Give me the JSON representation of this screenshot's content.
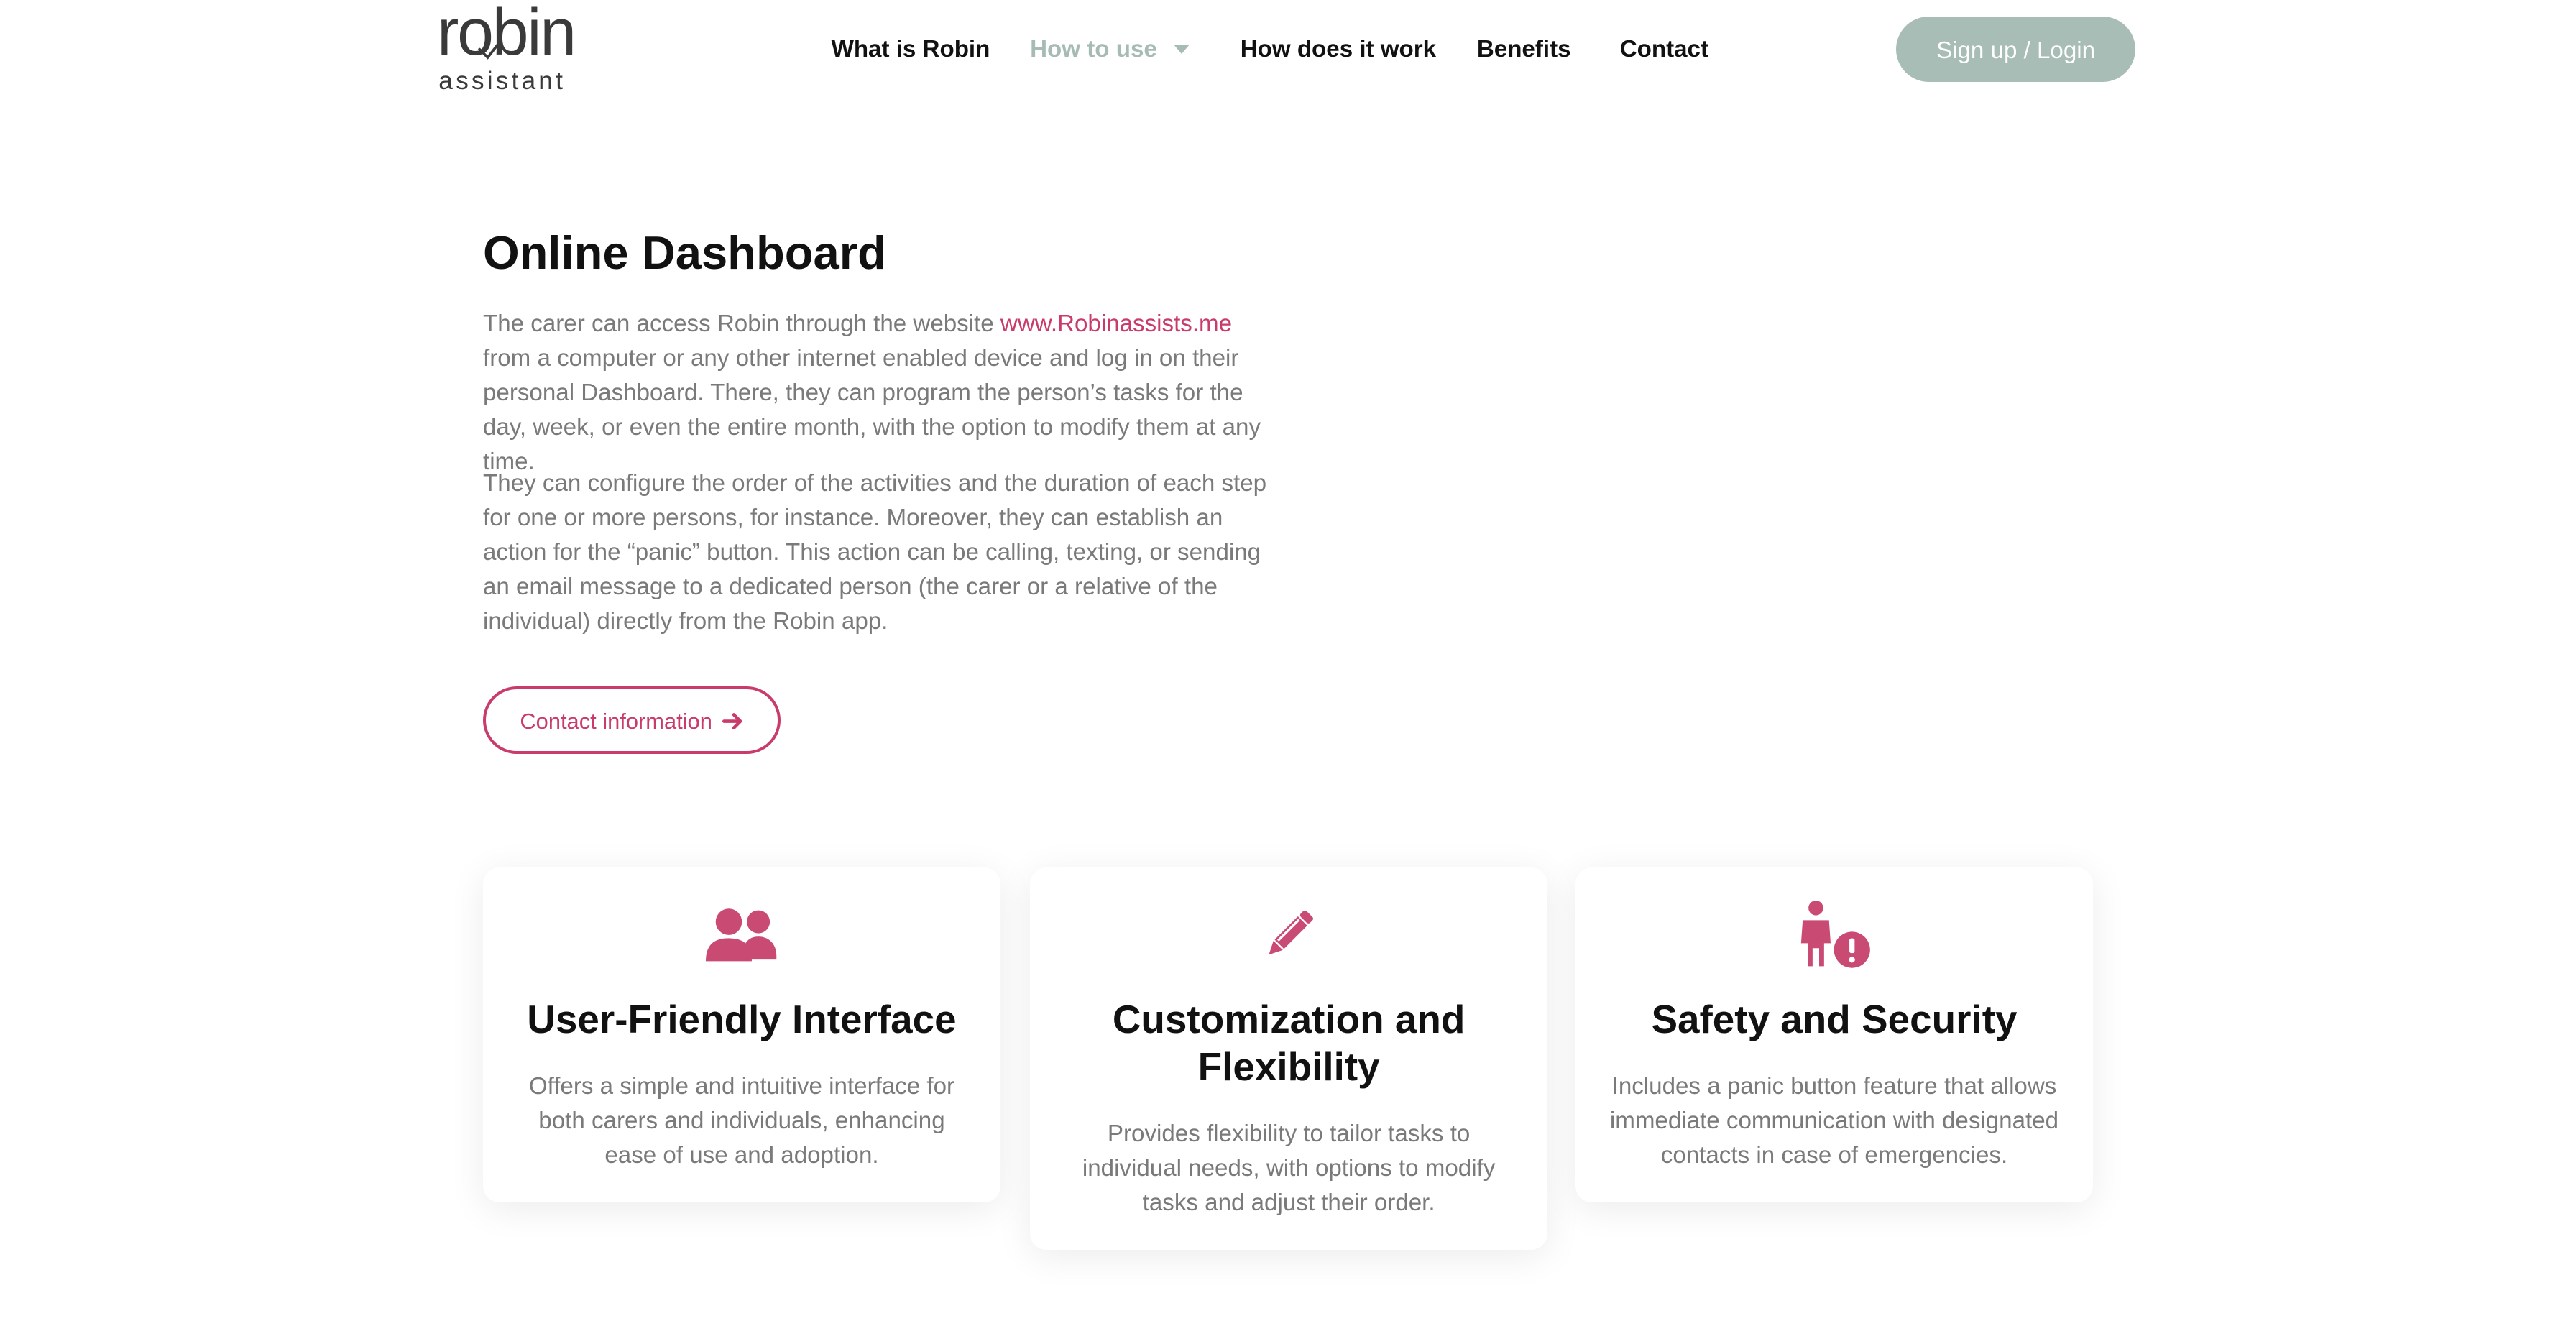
{
  "brand": {
    "logo_main": "robin",
    "logo_sub": "assistant"
  },
  "nav": {
    "items": [
      {
        "label": "What is Robin"
      },
      {
        "label": "How to use"
      },
      {
        "label": "How does it work"
      },
      {
        "label": "Benefits"
      },
      {
        "label": "Contact"
      }
    ],
    "login_label": "Sign up / Login"
  },
  "main": {
    "title": "Online Dashboard",
    "para1_before": "The carer can access Robin through the website ",
    "para1_link": "www.Robinassists.me",
    "para1_after": " from a computer or any other internet enabled device and log in on their personal Dashboard. There, they can program the person’s tasks for the day, week, or even the entire month, with the option to modify them at any time.",
    "para2": "They can configure the order of the activities and the duration of each step for one or more persons, for instance. Moreover, they can establish an action for the “panic” button. This action can be calling, texting, or sending an email message to a dedicated person (the carer or a relative of the individual) directly from the Robin app.",
    "contact_button": "Contact information"
  },
  "features": [
    {
      "icon": "users-icon",
      "title": "User-Friendly Interface",
      "text": "Offers a simple and intuitive interface for both carers and individuals, enhancing ease of use and adoption."
    },
    {
      "icon": "pencil-icon",
      "title": "Customization and Flexibility",
      "text": "Provides flexibility to tailor tasks to individual needs, with options to modify tasks and adjust their order."
    },
    {
      "icon": "person-alert-icon",
      "title": "Safety and Security",
      "text": "Includes a panic button feature that allows immediate communication with designated contacts in case of emergencies."
    }
  ],
  "colors": {
    "accent": "#c93b6a",
    "login_bg": "#a8bdb5",
    "nav_muted": "#a6bbb4",
    "body_text": "#7a7a7a"
  }
}
